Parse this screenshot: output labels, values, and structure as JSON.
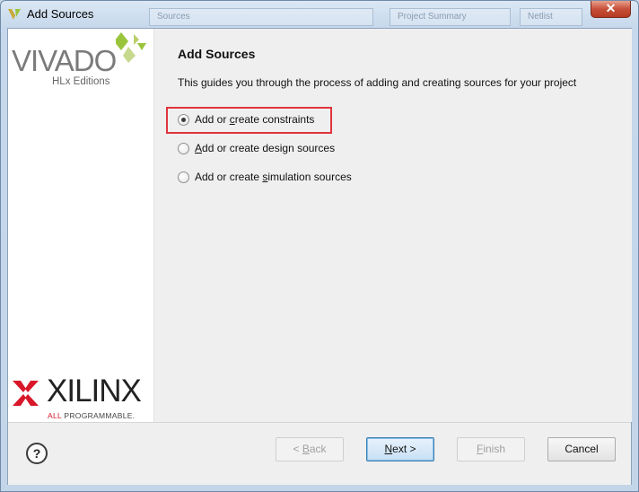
{
  "window": {
    "title": "Add Sources",
    "close_glyph": "✕"
  },
  "background_windows": {
    "tab1": "Sources",
    "tab2": "Project Summary",
    "tab3": "Netlist"
  },
  "branding": {
    "product": "VIVADO",
    "edition": "HLx Editions",
    "company": "XILINX",
    "tagline_prefix": "ALL",
    "tagline_rest": " PROGRAMMABLE."
  },
  "page": {
    "heading": "Add Sources",
    "description": "This guides you through the process of adding and creating sources for your project"
  },
  "options": [
    {
      "pre": "Add or ",
      "mn": "c",
      "post": "reate constraints",
      "selected": true
    },
    {
      "pre": "",
      "mn": "A",
      "post": "dd or create design sources",
      "selected": false
    },
    {
      "pre": "Add or create ",
      "mn": "s",
      "post": "imulation sources",
      "selected": false
    }
  ],
  "footer": {
    "help": "?",
    "back": {
      "pre": "< ",
      "mn": "B",
      "post": "ack"
    },
    "next": {
      "pre": "",
      "mn": "N",
      "post": "ext >"
    },
    "finish": {
      "pre": "",
      "mn": "F",
      "post": "inish"
    },
    "cancel": "Cancel"
  },
  "colors": {
    "highlight": "#e0343d",
    "vivado_green": "#9ac43c",
    "xilinx_red": "#d8182a"
  }
}
